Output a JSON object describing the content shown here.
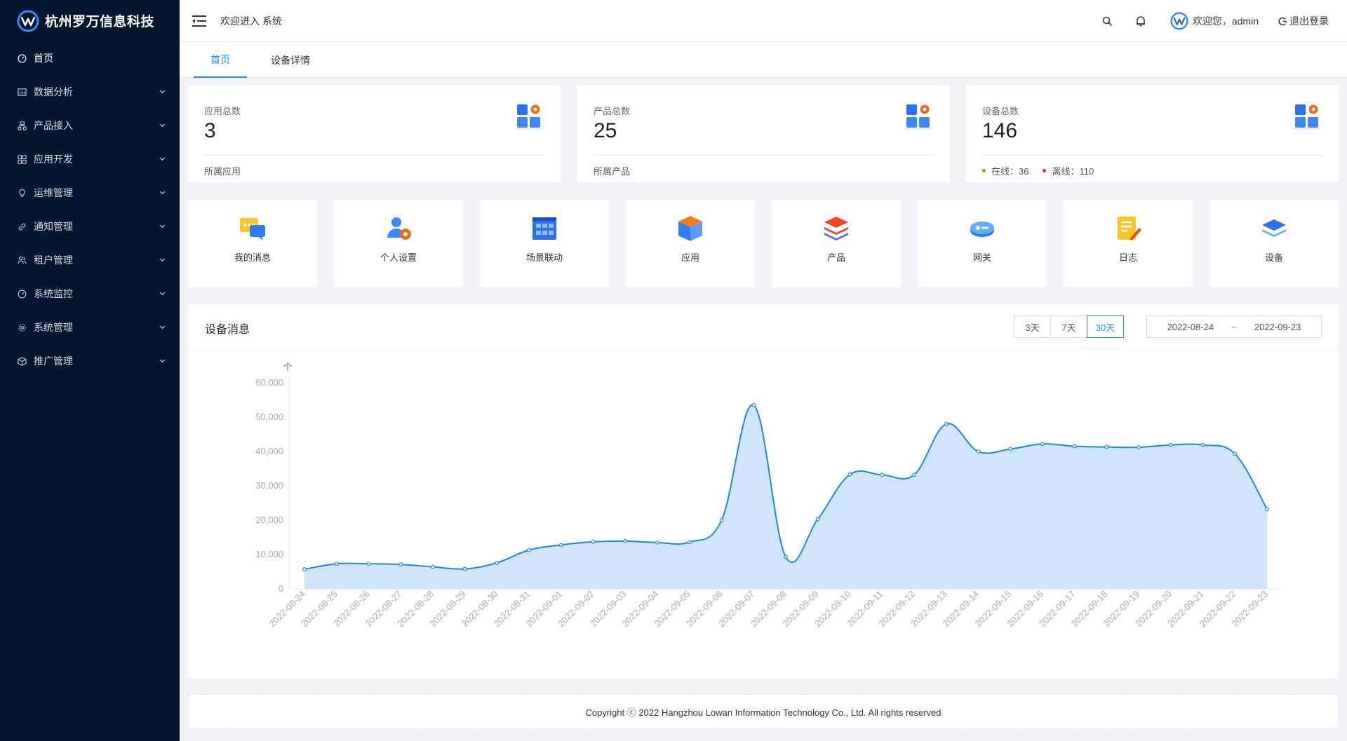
{
  "app": {
    "brand": "杭州罗万信息科技"
  },
  "sidebar": {
    "items": [
      {
        "label": "首页",
        "icon": "dashboard-icon",
        "active": true
      },
      {
        "label": "数据分析",
        "icon": "chart-box-icon"
      },
      {
        "label": "产品接入",
        "icon": "cluster-icon"
      },
      {
        "label": "应用开发",
        "icon": "appstore-icon"
      },
      {
        "label": "运维管理",
        "icon": "bulb-icon"
      },
      {
        "label": "通知管理",
        "icon": "link-icon"
      },
      {
        "label": "租户管理",
        "icon": "team-icon"
      },
      {
        "label": "系统监控",
        "icon": "gauge-icon"
      },
      {
        "label": "系统管理",
        "icon": "gear-icon"
      },
      {
        "label": "推广管理",
        "icon": "cube-icon"
      }
    ]
  },
  "header": {
    "welcome": "欢迎进入 系统",
    "user_greeting": "欢迎您，admin",
    "logout_label": "退出登录"
  },
  "tabs": [
    {
      "label": "首页",
      "active": true
    },
    {
      "label": "设备详情",
      "active": false
    }
  ],
  "stats": [
    {
      "title": "应用总数",
      "value": "3",
      "sub": "所属应用"
    },
    {
      "title": "产品总数",
      "value": "25",
      "sub": "所属产品"
    },
    {
      "title": "设备总数",
      "value": "146",
      "online_label": "在线：36",
      "offline_label": "离线：110",
      "online_color": "#52c41a",
      "offline_color": "#f5222d"
    }
  ],
  "tiles": [
    {
      "label": "我的消息",
      "icon": "message-icon"
    },
    {
      "label": "个人设置",
      "icon": "user-settings-icon"
    },
    {
      "label": "场景联动",
      "icon": "scene-icon"
    },
    {
      "label": "应用",
      "icon": "box-icon"
    },
    {
      "label": "产品",
      "icon": "layers-icon"
    },
    {
      "label": "网关",
      "icon": "gateway-icon"
    },
    {
      "label": "日志",
      "icon": "log-icon"
    },
    {
      "label": "设备",
      "icon": "device-icon"
    }
  ],
  "chart_card": {
    "title": "设备消息",
    "ranges": [
      {
        "label": "3天",
        "active": false
      },
      {
        "label": "7天",
        "active": false
      },
      {
        "label": "30天",
        "active": true
      }
    ],
    "date_start": "2022-08-24",
    "date_sep": "~",
    "date_end": "2022-09-23"
  },
  "chart_data": {
    "type": "area",
    "ylabel": "个",
    "ylim": [
      0,
      60000
    ],
    "yticks": [
      "0",
      "10,000",
      "20,000",
      "30,000",
      "40,000",
      "50,000",
      "60,000"
    ],
    "x": [
      "2022-08-24",
      "2022-08-25",
      "2022-08-26",
      "2022-08-27",
      "2022-08-28",
      "2022-08-29",
      "2022-08-30",
      "2022-08-31",
      "2022-09-01",
      "2022-09-02",
      "2022-09-03",
      "2022-09-04",
      "2022-09-05",
      "2022-09-06",
      "2022-09-07",
      "2022-09-08",
      "2022-09-09",
      "2022-09-10",
      "2022-09-11",
      "2022-09-12",
      "2022-09-13",
      "2022-09-14",
      "2022-09-15",
      "2022-09-16",
      "2022-09-17",
      "2022-09-18",
      "2022-09-19",
      "2022-09-20",
      "2022-09-21",
      "2022-09-22",
      "2022-09-23"
    ],
    "values": [
      5700,
      7300,
      7300,
      7100,
      6400,
      5800,
      7600,
      11300,
      12800,
      13700,
      13900,
      13500,
      13600,
      20000,
      53500,
      9300,
      20300,
      33300,
      33200,
      33200,
      48000,
      40000,
      40700,
      42200,
      41500,
      41300,
      41200,
      41900,
      41900,
      39300,
      23200
    ],
    "color": "#1e88d8",
    "fill": "#cfe5fb",
    "grid": false
  },
  "footer": {
    "text": "Copyright ⓒ 2022 Hangzhou Lowan Information Technology Co., Ltd. All rights reserved"
  }
}
